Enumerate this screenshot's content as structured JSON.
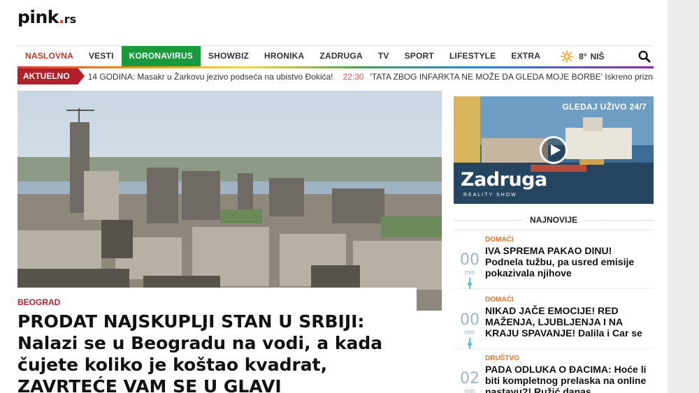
{
  "site": {
    "logo_main": "pink",
    "logo_dot": ".",
    "logo_tld": "rs"
  },
  "nav": {
    "items": [
      {
        "label": "NASLOVNA"
      },
      {
        "label": "VESTI"
      },
      {
        "label": "KORONAVIRUS",
        "active": true
      },
      {
        "label": "SHOWBIZ"
      },
      {
        "label": "HRONIKA"
      },
      {
        "label": "ZADRUGA"
      },
      {
        "label": "TV"
      },
      {
        "label": "SPORT"
      },
      {
        "label": "LIFESTYLE"
      },
      {
        "label": "EXTRA"
      }
    ],
    "weather": {
      "icon": "sun-icon",
      "temp": "8°",
      "city": "NIŠ"
    },
    "search_icon": "search-icon"
  },
  "ticker": {
    "label": "AKTUELNO",
    "item1": "14 GODINA: Masakr u Žarkovu jezivo podseća na ubistvo Đokića!",
    "time2": "22:30",
    "item2": "'TATA ZBOG INFARKTA NE MOŽE DA GLEDA MOJE BORBE' Iskreno priznanje Mili"
  },
  "hero": {
    "category": "BEOGRAD",
    "headline": "PRODAT NAJSKUPLJI STAN U SRBIJI: Nalazi se u Beogradu na vodi, a kada čujete koliko je koštao kvadrat, ZAVRTEĆE VAM SE U GLAVI"
  },
  "promo": {
    "live_label": "GLEDAJ UŽIVO 24/7",
    "brand": "Zadruga",
    "brand_sub": "REALITY SHOW"
  },
  "latest": {
    "title": "NAJNOVIJE",
    "items": [
      {
        "minutes": "00",
        "unit": "min",
        "category": "DOMAĆI",
        "title": "IVA SPREMA PAKAO DINU! Podnela tužbu, pa usred emisije pokazivala njihove"
      },
      {
        "minutes": "00",
        "unit": "min",
        "category": "DOMAĆI",
        "title": "NIKAD JAČE EMOCIJE! RED MAŽENJA, LJUBLJENJA I NA KRAJU SPAVANJE! Dalila i Car se"
      },
      {
        "minutes": "02",
        "unit": "min",
        "category": "DRUŠTVO",
        "title": "PADA ODLUKA O ĐACIMA: Hoće li biti kompletnog prelaska na online nastavu?! Ružić danas"
      }
    ]
  },
  "colors": {
    "brand_red": "#b3202a",
    "active_green": "#169a3b",
    "accent_orange": "#e8742a",
    "timeline_blue": "#5bc0de"
  }
}
